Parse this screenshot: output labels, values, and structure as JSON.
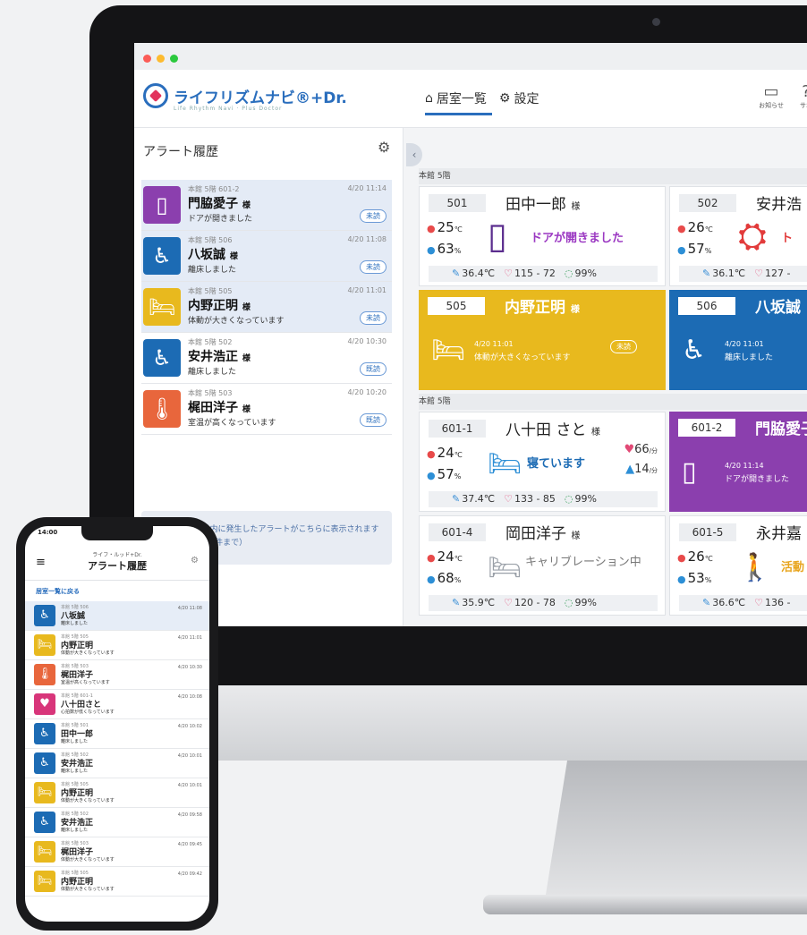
{
  "colors": {
    "accent": "#2a6ebd",
    "purple": "#8b3fae",
    "blue": "#1c6bb4",
    "yellow": "#e8b91e",
    "orange": "#e8663c",
    "pink": "#d8357a"
  },
  "app": {
    "logo_text": "ライフリズムナビ®+Dr.",
    "logo_sub": "Life Rhythm Navi · Plus Doctor",
    "tabs": [
      {
        "label": "居室一覧",
        "icon": "home-icon"
      },
      {
        "label": "設定",
        "icon": "gear-icon"
      }
    ],
    "header_icons": [
      {
        "label": "お知らせ",
        "icon": "notice-icon"
      },
      {
        "label": "サポ",
        "icon": "help-icon"
      }
    ]
  },
  "alert_panel": {
    "title": "アラート履歴",
    "items": [
      {
        "loc": "本館 5階 601-2",
        "time": "4/20 11:14",
        "name": "門脇愛子",
        "honor": "様",
        "msg": "ドアが開きました",
        "badge": "未読",
        "icon": "door-icon",
        "color": "purple",
        "selected": true
      },
      {
        "loc": "本館 5階 506",
        "time": "4/20 11:08",
        "name": "八坂誠",
        "honor": "様",
        "msg": "離床しました",
        "badge": "未読",
        "icon": "wheelchair-icon",
        "color": "blue",
        "selected": true
      },
      {
        "loc": "本館 5階 505",
        "time": "4/20 11:01",
        "name": "内野正明",
        "honor": "様",
        "msg": "体動が大きくなっています",
        "badge": "未読",
        "icon": "bed-icon",
        "color": "yellow",
        "selected": true
      },
      {
        "loc": "本館 5階 502",
        "time": "4/20 10:30",
        "name": "安井浩正",
        "honor": "様",
        "msg": "離床しました",
        "badge": "既読",
        "icon": "wheelchair-icon",
        "color": "blue",
        "selected": false
      },
      {
        "loc": "本館 5階 503",
        "time": "4/20 10:20",
        "name": "梶田洋子",
        "honor": "様",
        "msg": "室温が高くなっています",
        "badge": "既読",
        "icon": "thermometer-icon",
        "color": "orange",
        "selected": false
      }
    ],
    "notice": "24時間以内に発生したアラートがこちらに表示されます（最大300件まで）"
  },
  "rooms": {
    "floor_labels": [
      "本館 5階",
      "本館 5階"
    ],
    "cards": [
      {
        "room": "501",
        "name": "田中一郎",
        "honor": "様",
        "temp": "25",
        "temp_unit": "℃",
        "hum": "63",
        "hum_unit": "%",
        "state": "ドアが開きました",
        "state_icon": "door-icon",
        "body_temp": "36.4℃",
        "bp": "115 - 72",
        "spo2": "99%"
      },
      {
        "room": "502",
        "name": "安井浩",
        "honor": "",
        "temp": "26",
        "temp_unit": "℃",
        "hum": "57",
        "hum_unit": "%",
        "state": "ト",
        "state_icon": "toilet-icon",
        "body_temp": "36.1℃",
        "bp": "127 -",
        "spo2": ""
      },
      {
        "room": "601-1",
        "name": "八十田 さと",
        "honor": "様",
        "temp": "24",
        "temp_unit": "℃",
        "hum": "57",
        "hum_unit": "%",
        "state": "寝ています",
        "state_icon": "sleep-bed-icon",
        "heart": "66",
        "heart_unit": "/分",
        "resp": "14",
        "resp_unit": "/分",
        "body_temp": "37.4℃",
        "bp": "133 - 85",
        "spo2": "99%"
      },
      {
        "room": "601-4",
        "name": "岡田洋子",
        "honor": "様",
        "temp": "24",
        "temp_unit": "℃",
        "hum": "68",
        "hum_unit": "%",
        "state": "キャリブレーション中",
        "state_icon": "bed-icon",
        "body_temp": "35.9℃",
        "bp": "120 - 78",
        "spo2": "99%"
      },
      {
        "room": "601-5",
        "name": "永井嘉",
        "honor": "",
        "temp": "26",
        "temp_unit": "℃",
        "hum": "53",
        "hum_unit": "%",
        "state": "活動",
        "state_icon": "walking-icon",
        "body_temp": "36.6℃",
        "bp": "136 -",
        "spo2": ""
      }
    ],
    "alert_cards": [
      {
        "room": "505",
        "name": "内野正明",
        "honor": "様",
        "time": "4/20 11:01",
        "msg": "体動が大きくなっています",
        "badge": "未読",
        "icon": "bed-icon"
      },
      {
        "room": "506",
        "name": "八坂誠",
        "honor": "",
        "time": "4/20 11:01",
        "msg": "離床しました",
        "badge": "",
        "icon": "wheelchair-icon"
      },
      {
        "room": "601-2",
        "name": "門脇愛子",
        "honor": "",
        "time": "4/20 11:14",
        "msg": "ドアが開きました",
        "badge": "",
        "icon": "door-icon"
      }
    ]
  },
  "phone": {
    "status_time": "14:00",
    "brand": "ライフ・ルッド+Dr.",
    "title": "アラート履歴",
    "link": "居室一覧に戻る",
    "rows": [
      {
        "loc": "本館 5階 506",
        "name": "八坂誠",
        "msg": "離床しました",
        "time": "4/20 11:08",
        "icon": "wheelchair-icon",
        "color": "blue",
        "selected": true
      },
      {
        "loc": "本館 5階 505",
        "name": "内野正明",
        "msg": "体動が大きくなっています",
        "time": "4/20 11:01",
        "icon": "bed-icon",
        "color": "yellow",
        "selected": false
      },
      {
        "loc": "本館 5階 503",
        "name": "梶田洋子",
        "msg": "室温が高くなっています",
        "time": "4/20 10:30",
        "icon": "thermometer-icon",
        "color": "orange",
        "selected": false
      },
      {
        "loc": "本館 5階 601-1",
        "name": "八十田さと",
        "msg": "心拍数が低くなっています",
        "time": "4/20 10:08",
        "icon": "heart-icon",
        "color": "pink",
        "selected": false
      },
      {
        "loc": "本館 5階 501",
        "name": "田中一郎",
        "msg": "離床しました",
        "time": "4/20 10:02",
        "icon": "wheelchair-icon",
        "color": "blue",
        "selected": false
      },
      {
        "loc": "本館 5階 502",
        "name": "安井浩正",
        "msg": "離床しました",
        "time": "4/20 10:01",
        "icon": "wheelchair-icon",
        "color": "blue",
        "selected": false
      },
      {
        "loc": "本館 5階 505",
        "name": "内野正明",
        "msg": "体動が大きくなっています",
        "time": "4/20 10:01",
        "icon": "bed-icon",
        "color": "yellow",
        "selected": false
      },
      {
        "loc": "本館 5階 502",
        "name": "安井浩正",
        "msg": "離床しました",
        "time": "4/20 09:58",
        "icon": "wheelchair-icon",
        "color": "blue",
        "selected": false
      },
      {
        "loc": "本館 5階 503",
        "name": "梶田洋子",
        "msg": "体動が大きくなっています",
        "time": "4/20 09:45",
        "icon": "bed-icon",
        "color": "yellow",
        "selected": false
      },
      {
        "loc": "本館 5階 505",
        "name": "内野正明",
        "msg": "体動が大きくなっています",
        "time": "4/20 09:42",
        "icon": "bed-icon",
        "color": "yellow",
        "selected": false
      }
    ]
  }
}
